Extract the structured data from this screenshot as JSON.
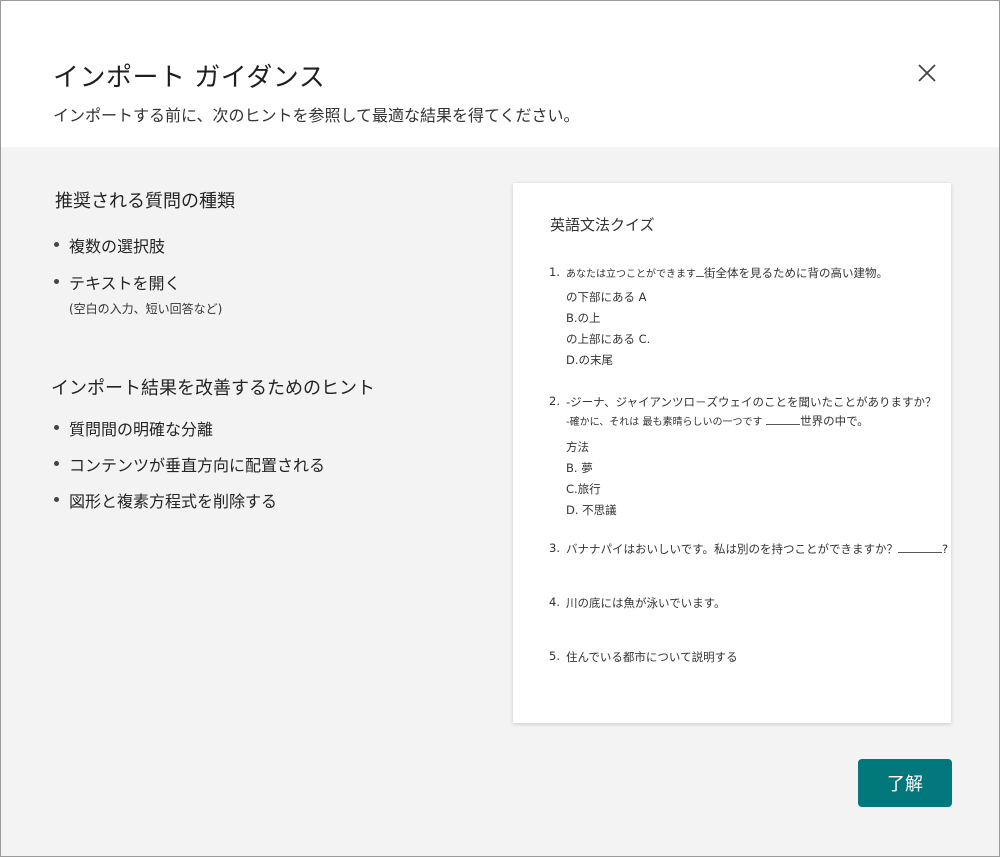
{
  "dialog": {
    "title": "インポート ガイダンス",
    "subtitle": "インポートする前に、次のヒントを参照して最適な結果を得てください。",
    "close_icon": "close-icon",
    "ok_label": "了解",
    "accent_color": "#03787c"
  },
  "recommended": {
    "heading": "推奨される質問の種類",
    "items": [
      "複数の選択肢",
      "テキストを開く"
    ],
    "note": "(空白の入力、短い回答など)"
  },
  "tips": {
    "heading": "インポート結果を改善するためのヒント",
    "items": [
      "質問間の明確な分離",
      "コンテンツが垂直方向に配置される",
      "図形と複素方程式を削除する"
    ]
  },
  "preview": {
    "title": "英語文法クイズ",
    "questions": [
      {
        "num": "1.",
        "text_a": "あなたは立つことができます",
        "text_b": "街全体を見るために背の高い建物。",
        "options": [
          "の下部にある A",
          "B.の上",
          "の上部にある C.",
          "D.の末尾"
        ]
      },
      {
        "num": "2.",
        "text": "-ジーナ、ジャイアンツロ－ズウェイのことを聞いたことがありますか？",
        "sub_a": "-確かに、それは 最も素晴らしいの一つです",
        "sub_b": "世界の中で。",
        "options": [
          "方法",
          "B. 夢",
          "C.旅行",
          "D. 不思議"
        ]
      },
      {
        "num": "3.",
        "text_a": "バナナパイはおいしいです。私は別のを持つことができますか？",
        "text_b": "?"
      },
      {
        "num": "4.",
        "text": "川の底には魚が泳いでいます。"
      },
      {
        "num": "5.",
        "text": "住んでいる都市について説明する"
      }
    ]
  }
}
